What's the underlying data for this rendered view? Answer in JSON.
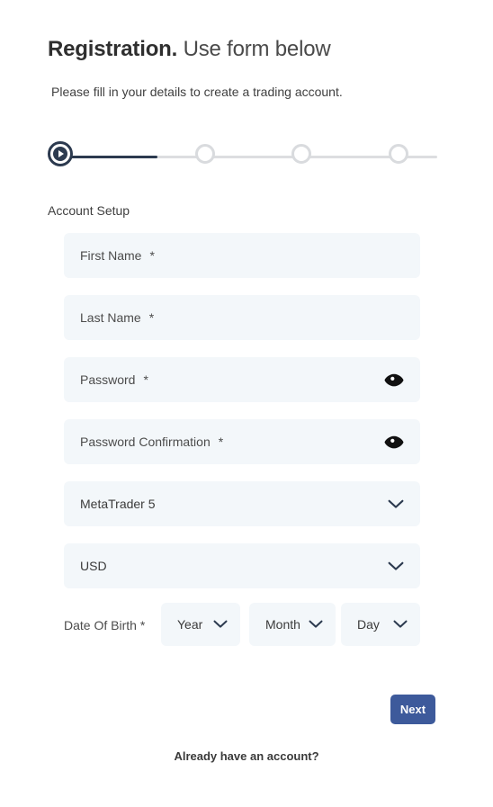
{
  "header": {
    "title_strong": "Registration.",
    "title_light": "Use form below",
    "subtitle": "Please fill in your details to create a trading account."
  },
  "stepper": {
    "active_index": 0,
    "total_steps": 4,
    "active_icon": "play-icon",
    "section_label": "Account Setup",
    "active_color": "#2c3a4f",
    "inactive_color": "#d9dbde"
  },
  "form": {
    "fields": [
      {
        "name": "first-name",
        "label": "First Name",
        "required_marker": "*",
        "value": "",
        "type": "text"
      },
      {
        "name": "last-name",
        "label": "Last Name",
        "required_marker": "*",
        "value": "",
        "type": "text"
      },
      {
        "name": "password",
        "label": "Password",
        "required_marker": "*",
        "value": "",
        "type": "password",
        "icon": "eye-icon"
      },
      {
        "name": "password-confirmation",
        "label": "Password Confirmation",
        "required_marker": "*",
        "value": "",
        "type": "password",
        "icon": "eye-icon"
      }
    ],
    "platform_select": {
      "name": "platform",
      "value": "MetaTrader 5",
      "icon": "chevron-down-icon"
    },
    "currency_select": {
      "name": "currency",
      "value": "USD",
      "icon": "chevron-down-icon"
    },
    "date_of_birth": {
      "label": "Date Of Birth",
      "required_marker": "*",
      "year": "Year",
      "month": "Month",
      "day": "Day",
      "icon": "chevron-down-icon"
    }
  },
  "footer": {
    "next_label": "Next",
    "next_color": "#3d5a9b",
    "account_link": "Already have an account?"
  },
  "colors": {
    "field_background": "#f3f7fa",
    "text": "#4c4c4c",
    "accent": "#2c3a4f"
  }
}
